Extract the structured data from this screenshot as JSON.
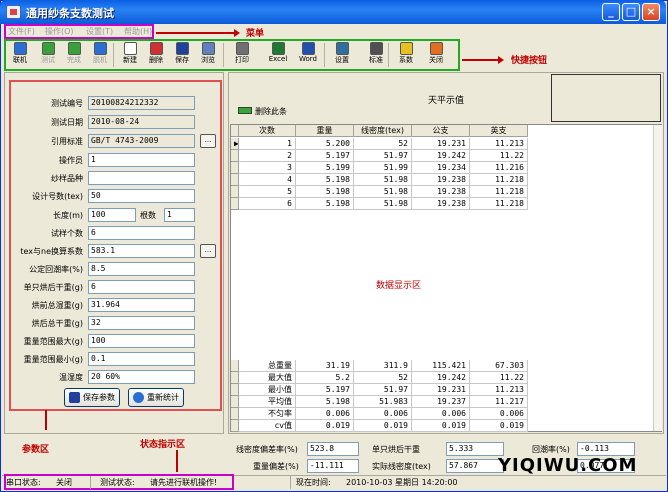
{
  "window": {
    "title": "通用纱条支数测试"
  },
  "menu": {
    "items": [
      "文件(F)",
      "操作(O)",
      "设置(T)",
      "帮助(H)"
    ]
  },
  "annotations": {
    "menu": "菜单",
    "toolbar": "快捷按钮",
    "params": "参数区",
    "status": "状态指示区",
    "data": "数据显示区"
  },
  "toolbar": {
    "items": [
      {
        "label": "联机",
        "icon": "connect-icon",
        "color": "#2a6fd6",
        "enabled": true
      },
      {
        "label": "测试",
        "icon": "test-icon",
        "color": "#3aa03a",
        "enabled": false
      },
      {
        "label": "完成",
        "icon": "finish-icon",
        "color": "#3aa03a",
        "enabled": false
      },
      {
        "label": "脱机",
        "icon": "disconnect-icon",
        "color": "#2a6fd6",
        "enabled": false
      },
      {
        "label": "新建",
        "icon": "new-file-icon",
        "color": "#ffffff",
        "enabled": true
      },
      {
        "label": "删除",
        "icon": "delete-icon",
        "color": "#d03030",
        "enabled": true
      },
      {
        "label": "保存",
        "icon": "save-icon",
        "color": "#2040a0",
        "enabled": true
      },
      {
        "label": "浏览",
        "icon": "browse-icon",
        "color": "#6080c0",
        "enabled": true
      },
      {
        "label": "打印",
        "icon": "print-icon",
        "color": "#707070",
        "enabled": true
      },
      {
        "label": "Excel",
        "icon": "excel-icon",
        "color": "#1d7a30",
        "enabled": true
      },
      {
        "label": "Word",
        "icon": "word-icon",
        "color": "#2050b0",
        "enabled": true
      },
      {
        "label": "设置",
        "icon": "settings-icon",
        "color": "#3070a0",
        "enabled": true
      },
      {
        "label": "标准",
        "icon": "standard-icon",
        "color": "#505050",
        "enabled": true
      },
      {
        "label": "系数",
        "icon": "coefficient-icon",
        "color": "#e8c020",
        "enabled": true
      },
      {
        "label": "关闭",
        "icon": "close-app-icon",
        "color": "#e07020",
        "enabled": true
      }
    ]
  },
  "params": {
    "test_id_label": "测试编号",
    "test_id": "20100824212332",
    "test_date_label": "测试日期",
    "test_date": "2010-08-24",
    "standard_label": "引用标准",
    "standard": "GB/T 4743-2009",
    "operator_label": "操作员",
    "operator": "1",
    "sample_label": "纱样品种",
    "sample": "",
    "design_count_label": "设计号数(tex)",
    "design_count": "50",
    "length_label": "长度(m)",
    "length": "100",
    "roots_label": "根数",
    "roots": "1",
    "sample_count_label": "试样个数",
    "sample_count": "6",
    "tex_ne_label": "tex与ne换算系数",
    "tex_ne": "583.1",
    "moisture_regain_label": "公定回潮率(%)",
    "moisture_regain": "8.5",
    "single_dry_label": "单只烘后干重(g)",
    "single_dry": "6",
    "pre_wet_label": "烘前总湿重(g)",
    "pre_wet": "31.964",
    "post_dry_label": "烘后总干重(g)",
    "post_dry": "32",
    "range_max_label": "重量范围最大(g)",
    "range_max": "100",
    "range_min_label": "重量范围最小(g)",
    "range_min": "0.1",
    "humidity_label": "温湿度",
    "humidity": "20 60%",
    "save_button": "保存参数",
    "restat_button": "重新统计"
  },
  "balance": {
    "title": "天平示值",
    "delete_label": "删除此条"
  },
  "table": {
    "headers": [
      "次数",
      "重量",
      "线密度(tex)",
      "公支",
      "英支"
    ],
    "rows": [
      [
        "1",
        "5.200",
        "52",
        "19.231",
        "11.213"
      ],
      [
        "2",
        "5.197",
        "51.97",
        "19.242",
        "11.22"
      ],
      [
        "3",
        "5.199",
        "51.99",
        "19.234",
        "11.216"
      ],
      [
        "4",
        "5.198",
        "51.98",
        "19.238",
        "11.218"
      ],
      [
        "5",
        "5.198",
        "51.98",
        "19.238",
        "11.218"
      ],
      [
        "6",
        "5.198",
        "51.98",
        "19.238",
        "11.218"
      ]
    ],
    "summary": [
      [
        "总重量",
        "31.19",
        "311.9",
        "115.421",
        "67.303"
      ],
      [
        "最大值",
        "5.2",
        "52",
        "19.242",
        "11.22"
      ],
      [
        "最小值",
        "5.197",
        "51.97",
        "19.231",
        "11.213"
      ],
      [
        "平均值",
        "5.198",
        "51.983",
        "19.237",
        "11.217"
      ],
      [
        "不匀率",
        "0.006",
        "0.006",
        "0.006",
        "0.006"
      ],
      [
        "cv值",
        "0.019",
        "0.019",
        "0.019",
        "0.019"
      ]
    ]
  },
  "stats": {
    "density_dev_label": "线密度偏差率(%)",
    "density_dev": "523.8",
    "single_dry_label": "单只烘后干重",
    "single_dry": "5.333",
    "regain_label": "回潮率(%)",
    "regain": "-0.113",
    "weight_dev_label": "重量偏差(%)",
    "weight_dev": "-11.111",
    "actual_density_label": "实际线密度(tex)",
    "actual_density": "57.867",
    "extra_value": "0.077"
  },
  "statusbar": {
    "port_label": "串口状态:",
    "port_value": "关闭",
    "test_label": "测试状态:",
    "test_value": "请先进行联机操作!",
    "time_label": "现在时间:",
    "time_value": "2010-10-03 星期日 14:20:00"
  },
  "watermark": "YIQIWU.COM"
}
